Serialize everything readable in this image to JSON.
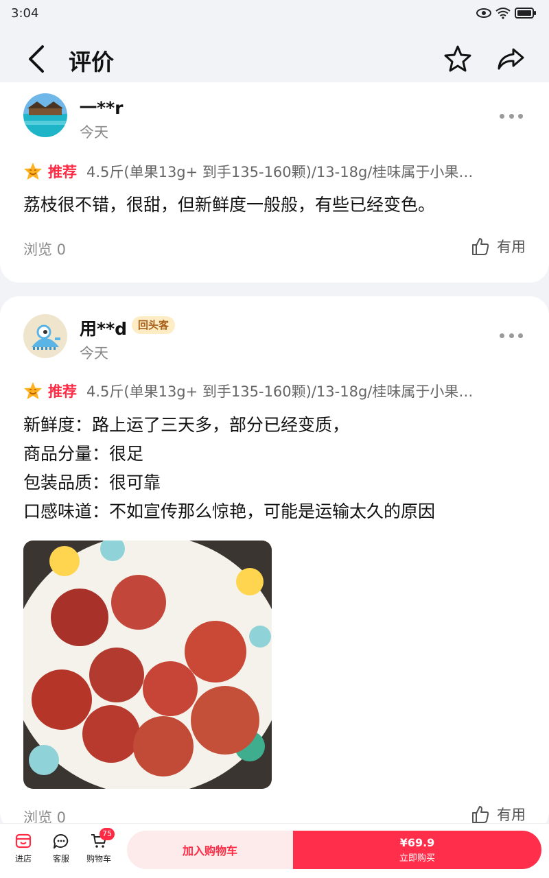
{
  "status_bar": {
    "time": "3:04"
  },
  "header": {
    "title": "评价"
  },
  "reviews": [
    {
      "username": "一**r",
      "date": "今天",
      "rec_label": "推荐",
      "spec": "4.5斤(单果13g+ 到手135-160颗)/13-18g/桂味属于小果…",
      "text_lines": [
        "荔枝很不错，很甜，但新鲜度一般般，有些已经变色。"
      ],
      "views": "浏览 0",
      "useful": "有用"
    },
    {
      "username": "用**d",
      "badge": "回头客",
      "date": "今天",
      "rec_label": "推荐",
      "spec": "4.5斤(单果13g+ 到手135-160颗)/13-18g/桂味属于小果…",
      "text_lines": [
        "新鲜度：路上运了三天多，部分已经变质，",
        "商品分量：很足",
        "包装品质：很可靠",
        "口感味道：不如宣传那么惊艳，可能是运输太久的原因"
      ],
      "views": "浏览 0",
      "useful": "有用"
    }
  ],
  "bottom_bar": {
    "store_label": "进店",
    "service_label": "客服",
    "cart_label": "购物车",
    "cart_count": "75",
    "add_to_cart": "加入购物车",
    "price": "¥69.9",
    "buy_now": "立即购买"
  },
  "colors": {
    "accent": "#ff2a43",
    "background": "#f2f3f7",
    "badge_bg": "#fdecc4",
    "badge_text": "#a8601b"
  }
}
